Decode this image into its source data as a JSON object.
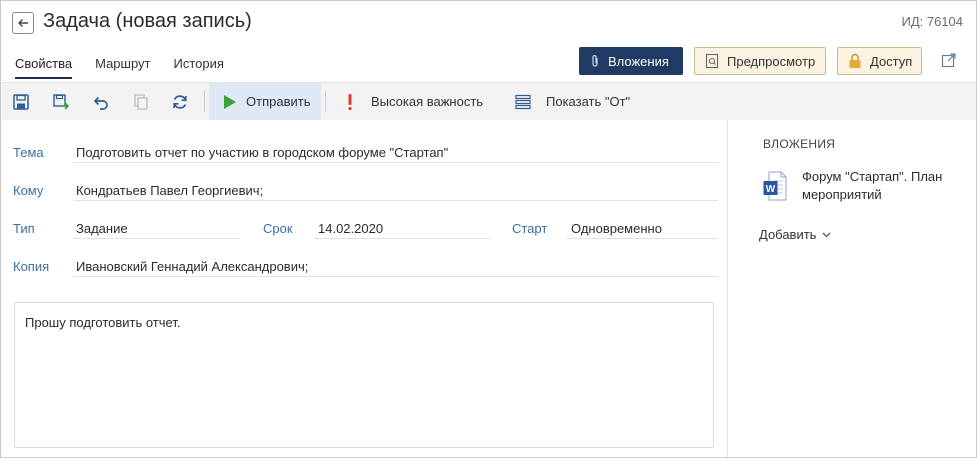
{
  "header": {
    "title": "Задача (новая запись)",
    "record_id": "ИД: 76104"
  },
  "tabs": [
    {
      "label": "Свойства",
      "active": true
    },
    {
      "label": "Маршрут",
      "active": false
    },
    {
      "label": "История",
      "active": false
    }
  ],
  "actions": {
    "attachments_label": "Вложения",
    "preview_label": "Предпросмотр",
    "access_label": "Доступ"
  },
  "toolbar": {
    "send_label": "Отправить",
    "importance_label": "Высокая важность",
    "show_from_label": "Показать \"От\""
  },
  "fields": {
    "subject": {
      "label": "Тема",
      "value": "Подготовить отчет по участию в городском форуме \"Стартап\""
    },
    "to": {
      "label": "Кому",
      "value": "Кондратьев Павел Георгиевич;"
    },
    "type": {
      "label": "Тип",
      "value": "Задание"
    },
    "deadline": {
      "label": "Срок",
      "value": "14.02.2020"
    },
    "start": {
      "label": "Старт",
      "value": "Одновременно"
    },
    "copy": {
      "label": "Копия",
      "value": "Ивановский Геннадий Александрович;"
    }
  },
  "body_text": "Прошу подготовить отчет.",
  "attachments_panel": {
    "title": "ВЛОЖЕНИЯ",
    "files": [
      {
        "name": "Форум \"Стартап\". План мероприятий",
        "icon": "word-doc-icon"
      }
    ],
    "add_label": "Добавить"
  },
  "colors": {
    "accent_dark": "#1f3a63",
    "label_blue": "#3d6fa5",
    "send_green": "#3aa33a",
    "importance_red": "#e03a2a",
    "word_blue": "#2b579a"
  }
}
